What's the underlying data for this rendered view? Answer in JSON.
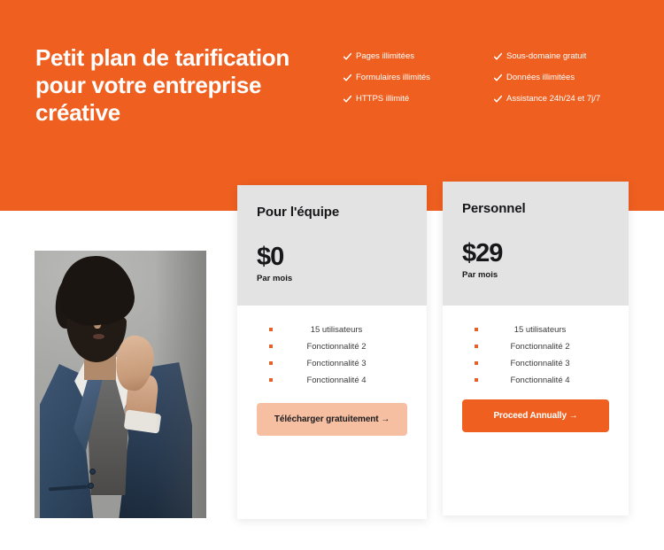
{
  "theme": {
    "accent": "#ef6020",
    "accent_soft": "#f7bfa2",
    "card_head_bg": "#e3e3e3",
    "text_dark": "#17171a"
  },
  "hero": {
    "title": "Petit plan de tarification pour votre entreprise créative",
    "features_left": [
      {
        "icon": "check-icon",
        "label": "Pages illimitées"
      },
      {
        "icon": "check-icon",
        "label": "Formulaires illimités"
      },
      {
        "icon": "check-icon",
        "label": "HTTPS illimité"
      }
    ],
    "features_right": [
      {
        "icon": "check-icon",
        "label": "Sous-domaine gratuit"
      },
      {
        "icon": "check-icon",
        "label": "Données illimitées"
      },
      {
        "icon": "check-icon",
        "label": "Assistance 24h/24 et 7j/7"
      }
    ]
  },
  "photo": {
    "alt": "portrait-photo-man-in-blue-blazer"
  },
  "plans": [
    {
      "id": "team",
      "title": "Pour l'équipe",
      "price": "$0",
      "period": "Par mois",
      "features": [
        "15 utilisateurs",
        "Fonctionnalité 2",
        "Fonctionnalité 3",
        "Fonctionnalité 4"
      ],
      "cta_label": "Télécharger gratuitement →"
    },
    {
      "id": "personal",
      "title": "Personnel",
      "price": "$29",
      "period": "Par mois",
      "features": [
        "15 utilisateurs",
        "Fonctionnalité 2",
        "Fonctionnalité 3",
        "Fonctionnalité 4"
      ],
      "cta_label": "Proceed Annually →"
    }
  ]
}
